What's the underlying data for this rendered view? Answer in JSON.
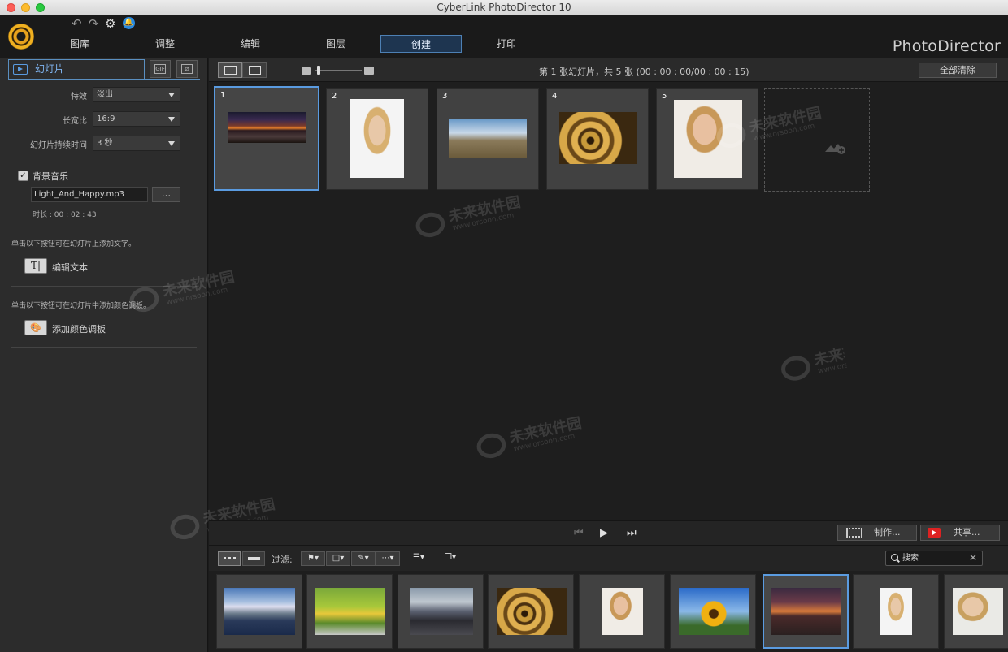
{
  "window": {
    "title": "CyberLink PhotoDirector 10"
  },
  "header": {
    "tabs": [
      {
        "label": "图库"
      },
      {
        "label": "调整"
      },
      {
        "label": "编辑"
      },
      {
        "label": "图层"
      },
      {
        "label": "创建",
        "active": true
      },
      {
        "label": "打印"
      }
    ],
    "brand": "PhotoDirector",
    "icons": [
      "undo-icon",
      "redo-icon",
      "settings-gear-icon",
      "notification-bell-icon"
    ]
  },
  "left_panel": {
    "tab_label": "幻灯片",
    "settings": [
      {
        "label": "特效",
        "value": "淡出"
      },
      {
        "label": "长宽比",
        "value": "16:9"
      },
      {
        "label": "幻灯片持续时间",
        "value": "3 秒"
      }
    ],
    "music": {
      "checked": true,
      "label": "背景音乐",
      "file": "Light_And_Happy.mp3",
      "more_label": "...",
      "duration": "时长 : 00 : 02 : 43"
    },
    "text_hint": "单击以下按钮可在幻灯片上添加文字。",
    "edit_text_icon": "T|",
    "edit_text_label": "编辑文本",
    "color_hint": "单击以下按钮可在幻灯片中添加颜色调板。",
    "add_color_label": "添加颜色调板"
  },
  "storyboard": {
    "info": "第  1 张幻灯片，共  5 张 (00 : 00 : 00/00 : 00 : 15)",
    "clear_label": "全部清除",
    "slides": [
      {
        "num": "1",
        "image": "sunset-clouds",
        "selected": true
      },
      {
        "num": "2",
        "image": "woman-portrait"
      },
      {
        "num": "3",
        "image": "panorama-landscape"
      },
      {
        "num": "4",
        "image": "spiral-staircase"
      },
      {
        "num": "5",
        "image": "smiling-woman"
      }
    ]
  },
  "player": {
    "make_label": "制作...",
    "share_label": "共享..."
  },
  "filter_bar": {
    "filter_label": "过滤:",
    "search_placeholder": "搜索"
  },
  "filmstrip": [
    {
      "image": "mountain-lake"
    },
    {
      "image": "bicycle-field"
    },
    {
      "image": "church-dusk"
    },
    {
      "image": "spiral-staircase"
    },
    {
      "image": "smiling-woman"
    },
    {
      "image": "sunflower"
    },
    {
      "image": "sunset-clouds",
      "selected": true
    },
    {
      "image": "woman-portrait"
    },
    {
      "image": "woman-portrait-2"
    }
  ],
  "watermark": {
    "text": "未来软件园",
    "url": "www.orsoon.com"
  },
  "colors": {
    "accent": "#5a9be0",
    "panel": "#2c2c2c",
    "background": "#1e1e1e"
  }
}
